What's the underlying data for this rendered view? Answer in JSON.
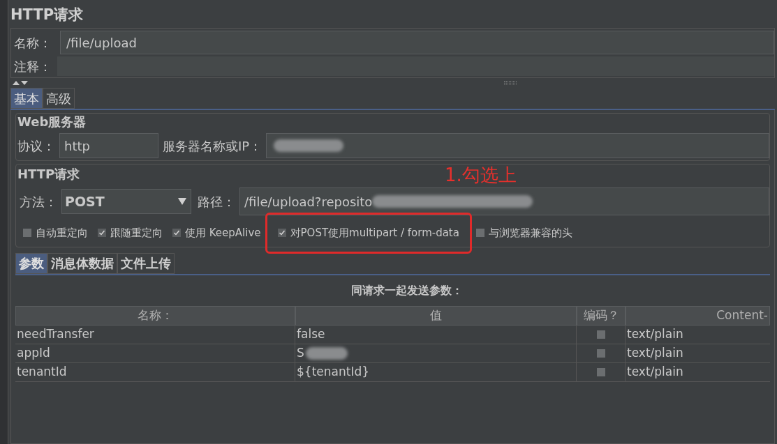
{
  "title": "HTTP请求",
  "name_field": {
    "label": "名称：",
    "value": "/file/upload"
  },
  "comment_field": {
    "label": "注释："
  },
  "tabs": [
    {
      "label": "基本",
      "selected": true
    },
    {
      "label": "高级",
      "selected": false
    }
  ],
  "web_server": {
    "title": "Web服务器",
    "protocol": {
      "label": "协议：",
      "value": "http"
    },
    "server": {
      "label": "服务器名称或IP："
    }
  },
  "http_request": {
    "title": "HTTP请求",
    "method": {
      "label": "方法：",
      "value": "POST"
    },
    "path": {
      "label": "路径：",
      "value": "/file/upload?reposito"
    },
    "options": [
      {
        "label": "自动重定向",
        "checked": false
      },
      {
        "label": "跟随重定向",
        "checked": true
      },
      {
        "label": "使用 KeepAlive",
        "checked": true
      },
      {
        "label": "对POST使用multipart / form-data",
        "checked": true,
        "highlighted": true
      },
      {
        "label": "与浏览器兼容的头",
        "checked": false
      }
    ]
  },
  "sub_tabs": [
    {
      "label": "参数",
      "selected": true
    },
    {
      "label": "消息体数据",
      "selected": false
    },
    {
      "label": "文件上传",
      "selected": false
    }
  ],
  "params": {
    "caption": "同请求一起发送参数：",
    "columns": [
      "名称：",
      "值",
      "编码？",
      "Content-"
    ],
    "rows": [
      {
        "name": "needTransfer",
        "value": "false",
        "encode": false,
        "content_type": "text/plain"
      },
      {
        "name": "appId",
        "value": "S",
        "value_blurred": true,
        "encode": false,
        "content_type": "text/plain"
      },
      {
        "name": "tenantId",
        "value": "${tenantId}",
        "encode": false,
        "content_type": "text/plain"
      }
    ]
  },
  "annotation": {
    "text": "1.勾选上"
  }
}
